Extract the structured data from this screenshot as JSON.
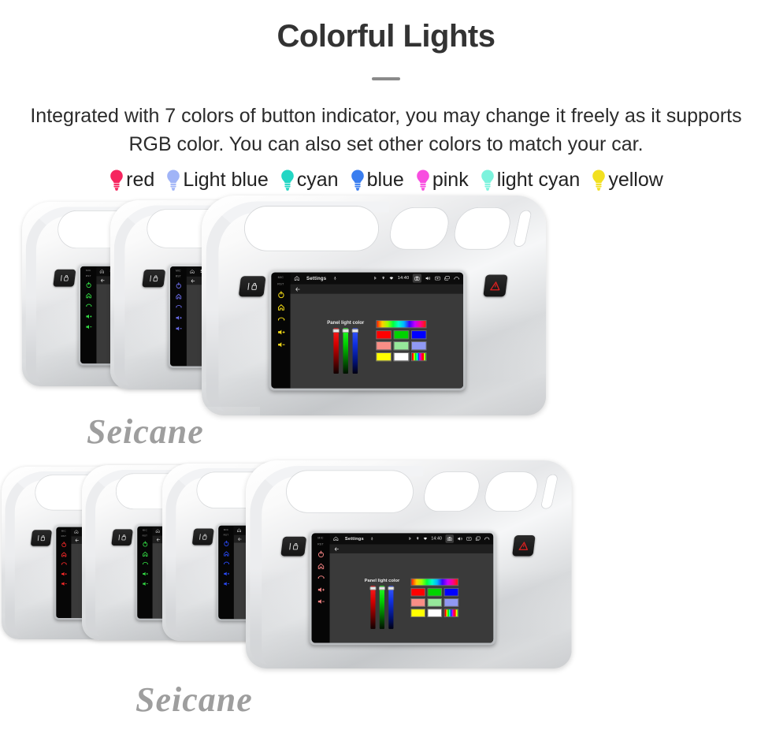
{
  "header": {
    "title": "Colorful Lights",
    "subtitle": "Integrated with 7 colors of button indicator, you may change it freely as it supports RGB color. You can also set other colors to match your car."
  },
  "legend": {
    "items": [
      {
        "label": "red",
        "color": "#f6255f"
      },
      {
        "label": "Light blue",
        "color": "#a0b4f7"
      },
      {
        "label": "cyan",
        "color": "#23d6c4"
      },
      {
        "label": "blue",
        "color": "#3a7ef0"
      },
      {
        "label": "pink",
        "color": "#f84de0"
      },
      {
        "label": "light cyan",
        "color": "#7cf3dd"
      },
      {
        "label": "yellow",
        "color": "#f2e020"
      }
    ]
  },
  "device_screen": {
    "statusbar": {
      "home_icon": "home-icon",
      "title": "Settings",
      "mic_icon": "microphone-icon",
      "bluetooth_icon": "bluetooth-icon",
      "location_icon": "location-icon",
      "wifi_icon": "wifi-icon",
      "clock": "14:40",
      "camera_icon": "camera-icon",
      "volume_icon": "volume-icon",
      "screenshot_icon": "screenshot-icon",
      "recents_icon": "recents-icon",
      "back_icon": "back-arrow-icon"
    },
    "subbar": {
      "back_icon": "back-arrow-icon"
    },
    "panel": {
      "caption": "Panel light color",
      "sliders": [
        {
          "name": "red-slider",
          "color": "#ff2020"
        },
        {
          "name": "green-slider",
          "color": "#2aff2a"
        },
        {
          "name": "blue-slider",
          "color": "#3a5cff"
        }
      ],
      "swatch_rows": [
        [
          {
            "name": "rainbow-gradient-swatch",
            "style": "rainbow"
          }
        ],
        [
          {
            "name": "red-swatch",
            "color": "#ff0000"
          },
          {
            "name": "green-swatch",
            "color": "#00d400"
          },
          {
            "name": "blue-swatch",
            "color": "#0000ff"
          }
        ],
        [
          {
            "name": "light-red-swatch",
            "color": "#f98e86"
          },
          {
            "name": "light-green-swatch",
            "color": "#96e79a"
          },
          {
            "name": "light-blue-swatch",
            "color": "#9099f3"
          }
        ],
        [
          {
            "name": "yellow-swatch",
            "color": "#ffff00"
          },
          {
            "name": "white-swatch",
            "color": "#ffffff"
          },
          {
            "name": "rainbow-stripes-swatch",
            "style": "stripes"
          }
        ]
      ]
    }
  },
  "units": {
    "button_strip": {
      "mic_label": "MIC",
      "rst_label": "RST",
      "icons": [
        "power-icon",
        "home-icon",
        "back-icon",
        "volume-up-icon",
        "volume-down-icon"
      ]
    },
    "side_buttons": {
      "lock_button": "door-lock-button",
      "hazard_button": "hazard-lights-button"
    },
    "top_row": [
      {
        "name": "radio-unit-green",
        "led_color": "#33dd44"
      },
      {
        "name": "radio-unit-blue",
        "led_color": "#6a6ce8"
      },
      {
        "name": "radio-unit-yellow",
        "led_color": "#f2d916",
        "is_front": true
      }
    ],
    "bottom_row": [
      {
        "name": "radio-unit-red",
        "led_color": "#ff2a2a"
      },
      {
        "name": "radio-unit-green2",
        "led_color": "#33dd44"
      },
      {
        "name": "radio-unit-blue2",
        "led_color": "#2a4cff"
      },
      {
        "name": "radio-unit-pink",
        "led_color": "#f08080",
        "is_front": true
      }
    ]
  },
  "watermark": {
    "text": "Seicane"
  }
}
